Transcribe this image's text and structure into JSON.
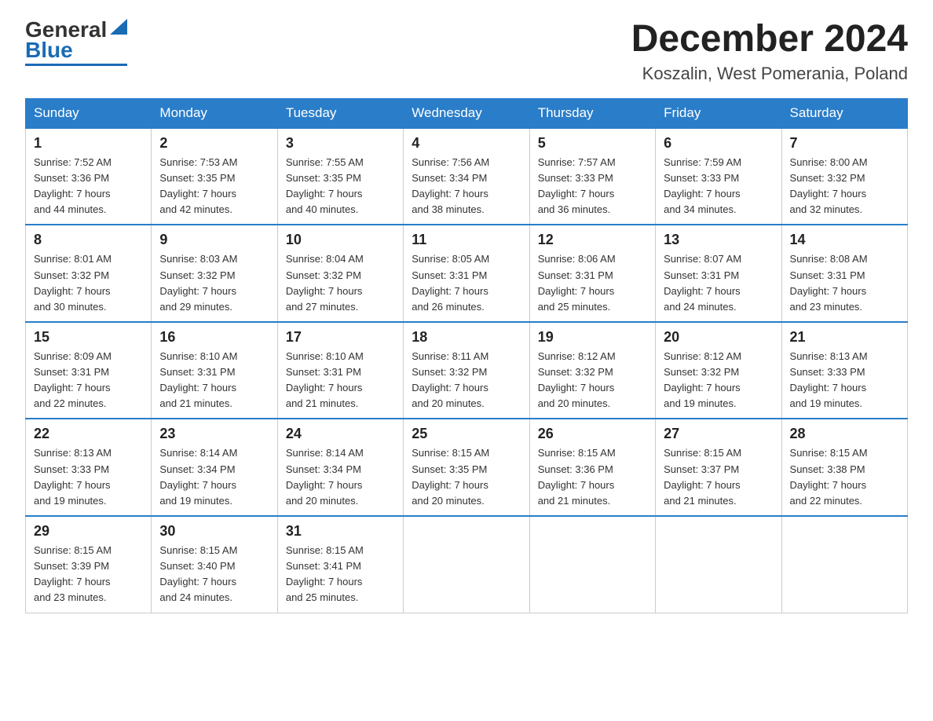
{
  "logo": {
    "general": "General",
    "blue": "Blue"
  },
  "title": "December 2024",
  "subtitle": "Koszalin, West Pomerania, Poland",
  "days_of_week": [
    "Sunday",
    "Monday",
    "Tuesday",
    "Wednesday",
    "Thursday",
    "Friday",
    "Saturday"
  ],
  "weeks": [
    [
      {
        "day": "1",
        "sunrise": "7:52 AM",
        "sunset": "3:36 PM",
        "daylight": "7 hours and 44 minutes."
      },
      {
        "day": "2",
        "sunrise": "7:53 AM",
        "sunset": "3:35 PM",
        "daylight": "7 hours and 42 minutes."
      },
      {
        "day": "3",
        "sunrise": "7:55 AM",
        "sunset": "3:35 PM",
        "daylight": "7 hours and 40 minutes."
      },
      {
        "day": "4",
        "sunrise": "7:56 AM",
        "sunset": "3:34 PM",
        "daylight": "7 hours and 38 minutes."
      },
      {
        "day": "5",
        "sunrise": "7:57 AM",
        "sunset": "3:33 PM",
        "daylight": "7 hours and 36 minutes."
      },
      {
        "day": "6",
        "sunrise": "7:59 AM",
        "sunset": "3:33 PM",
        "daylight": "7 hours and 34 minutes."
      },
      {
        "day": "7",
        "sunrise": "8:00 AM",
        "sunset": "3:32 PM",
        "daylight": "7 hours and 32 minutes."
      }
    ],
    [
      {
        "day": "8",
        "sunrise": "8:01 AM",
        "sunset": "3:32 PM",
        "daylight": "7 hours and 30 minutes."
      },
      {
        "day": "9",
        "sunrise": "8:03 AM",
        "sunset": "3:32 PM",
        "daylight": "7 hours and 29 minutes."
      },
      {
        "day": "10",
        "sunrise": "8:04 AM",
        "sunset": "3:32 PM",
        "daylight": "7 hours and 27 minutes."
      },
      {
        "day": "11",
        "sunrise": "8:05 AM",
        "sunset": "3:31 PM",
        "daylight": "7 hours and 26 minutes."
      },
      {
        "day": "12",
        "sunrise": "8:06 AM",
        "sunset": "3:31 PM",
        "daylight": "7 hours and 25 minutes."
      },
      {
        "day": "13",
        "sunrise": "8:07 AM",
        "sunset": "3:31 PM",
        "daylight": "7 hours and 24 minutes."
      },
      {
        "day": "14",
        "sunrise": "8:08 AM",
        "sunset": "3:31 PM",
        "daylight": "7 hours and 23 minutes."
      }
    ],
    [
      {
        "day": "15",
        "sunrise": "8:09 AM",
        "sunset": "3:31 PM",
        "daylight": "7 hours and 22 minutes."
      },
      {
        "day": "16",
        "sunrise": "8:10 AM",
        "sunset": "3:31 PM",
        "daylight": "7 hours and 21 minutes."
      },
      {
        "day": "17",
        "sunrise": "8:10 AM",
        "sunset": "3:31 PM",
        "daylight": "7 hours and 21 minutes."
      },
      {
        "day": "18",
        "sunrise": "8:11 AM",
        "sunset": "3:32 PM",
        "daylight": "7 hours and 20 minutes."
      },
      {
        "day": "19",
        "sunrise": "8:12 AM",
        "sunset": "3:32 PM",
        "daylight": "7 hours and 20 minutes."
      },
      {
        "day": "20",
        "sunrise": "8:12 AM",
        "sunset": "3:32 PM",
        "daylight": "7 hours and 19 minutes."
      },
      {
        "day": "21",
        "sunrise": "8:13 AM",
        "sunset": "3:33 PM",
        "daylight": "7 hours and 19 minutes."
      }
    ],
    [
      {
        "day": "22",
        "sunrise": "8:13 AM",
        "sunset": "3:33 PM",
        "daylight": "7 hours and 19 minutes."
      },
      {
        "day": "23",
        "sunrise": "8:14 AM",
        "sunset": "3:34 PM",
        "daylight": "7 hours and 19 minutes."
      },
      {
        "day": "24",
        "sunrise": "8:14 AM",
        "sunset": "3:34 PM",
        "daylight": "7 hours and 20 minutes."
      },
      {
        "day": "25",
        "sunrise": "8:15 AM",
        "sunset": "3:35 PM",
        "daylight": "7 hours and 20 minutes."
      },
      {
        "day": "26",
        "sunrise": "8:15 AM",
        "sunset": "3:36 PM",
        "daylight": "7 hours and 21 minutes."
      },
      {
        "day": "27",
        "sunrise": "8:15 AM",
        "sunset": "3:37 PM",
        "daylight": "7 hours and 21 minutes."
      },
      {
        "day": "28",
        "sunrise": "8:15 AM",
        "sunset": "3:38 PM",
        "daylight": "7 hours and 22 minutes."
      }
    ],
    [
      {
        "day": "29",
        "sunrise": "8:15 AM",
        "sunset": "3:39 PM",
        "daylight": "7 hours and 23 minutes."
      },
      {
        "day": "30",
        "sunrise": "8:15 AM",
        "sunset": "3:40 PM",
        "daylight": "7 hours and 24 minutes."
      },
      {
        "day": "31",
        "sunrise": "8:15 AM",
        "sunset": "3:41 PM",
        "daylight": "7 hours and 25 minutes."
      },
      null,
      null,
      null,
      null
    ]
  ],
  "labels": {
    "sunrise": "Sunrise:",
    "sunset": "Sunset:",
    "daylight": "Daylight:"
  }
}
